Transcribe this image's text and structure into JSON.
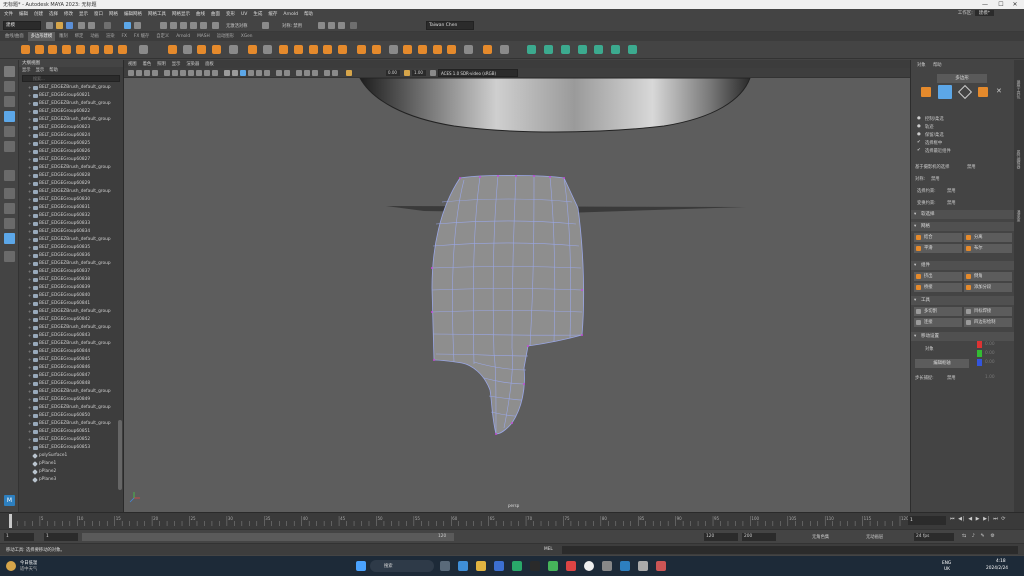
{
  "window": {
    "title": "无标题* - Autodesk MAYA 2023: 无标题",
    "controls": [
      "—",
      "☐",
      "✕"
    ]
  },
  "menubar": [
    "文件",
    "编辑",
    "创建",
    "选择",
    "修改",
    "显示",
    "窗口",
    "网格",
    "编辑网格",
    "网格工具",
    "网格显示",
    "曲线",
    "曲面",
    "变形",
    "UV",
    "生成",
    "缓存",
    "Arnold",
    "帮助"
  ],
  "workspace": {
    "label": "工作区:",
    "value": "建模*"
  },
  "statusline": {
    "mode": "建模",
    "symmetry": "无激活对称",
    "no_live": "对称: 禁用",
    "user": "Taiwan Chen"
  },
  "shelf_tabs": [
    "曲线/曲面",
    "多边形建模",
    "雕刻",
    "绑定",
    "动画",
    "渲染",
    "FX",
    "FX 缓存",
    "自定义",
    "Arnold",
    "MASH",
    "运动图形",
    "XGen"
  ],
  "shelf_active": "多边形建模",
  "outliner": {
    "title": "大纲视图",
    "menu": [
      "显示",
      "显示",
      "帮助"
    ],
    "search_placeholder": "搜索...",
    "items": [
      "BELT_EDGEZBrush_default_group",
      "BELT_EDGEGroup60821",
      "BELT_EDGEZBrush_default_group",
      "BELT_EDGEGroup60822",
      "BELT_EDGEZBrush_default_group",
      "BELT_EDGEGroup60823",
      "BELT_EDGEGroup60824",
      "BELT_EDGEGroup60825",
      "BELT_EDGEGroup60826",
      "BELT_EDGEGroup60827",
      "BELT_EDGEZBrush_default_group",
      "BELT_EDGEGroup60828",
      "BELT_EDGEGroup60829",
      "BELT_EDGEZBrush_default_group",
      "BELT_EDGEGroup60830",
      "BELT_EDGEGroup60831",
      "BELT_EDGEGroup60832",
      "BELT_EDGEGroup60833",
      "BELT_EDGEGroup60834",
      "BELT_EDGEZBrush_default_group",
      "BELT_EDGEGroup60835",
      "BELT_EDGEGroup60836",
      "BELT_EDGEZBrush_default_group",
      "BELT_EDGEGroup60837",
      "BELT_EDGEGroup60838",
      "BELT_EDGEGroup60839",
      "BELT_EDGEGroup60840",
      "BELT_EDGEGroup60841",
      "BELT_EDGEZBrush_default_group",
      "BELT_EDGEGroup60842",
      "BELT_EDGEZBrush_default_group",
      "BELT_EDGEGroup60843",
      "BELT_EDGEZBrush_default_group",
      "BELT_EDGEGroup60844",
      "BELT_EDGEGroup60845",
      "BELT_EDGEGroup60846",
      "BELT_EDGEGroup60847",
      "BELT_EDGEGroup60848",
      "BELT_EDGEZBrush_default_group",
      "BELT_EDGEGroup60849",
      "BELT_EDGEZBrush_default_group",
      "BELT_EDGEGroup60850",
      "BELT_EDGEZBrush_default_group",
      "BELT_EDGEGroup60851",
      "BELT_EDGEGroup60852",
      "BELT_EDGEGroup60853"
    ],
    "mesh_items": [
      "polySurface1",
      "pPlane1",
      "pPlane2",
      "pPlane3"
    ]
  },
  "viewport": {
    "menu": [
      "视图",
      "着色",
      "照明",
      "显示",
      "渲染器",
      "面板"
    ],
    "field_value": "0.00",
    "field_value2": "1.00",
    "colorspace": "ACES 1.0 SDR-video (sRGB)",
    "camera_label": "persp"
  },
  "attr_panel": {
    "tabs": [
      "对象",
      "帮助"
    ],
    "mode_button": "多边形",
    "options": [
      "控制/柔选",
      "轨迹",
      "保留/柔选",
      "选择框中",
      "选择最近组件"
    ],
    "soft_label": "基于摄影机的选择",
    "soft_value": "禁用",
    "symmetry_label": "对称:",
    "symmetry_value": "禁用",
    "edge_label": "选择约束:",
    "edge_value": "禁用",
    "tool_label": "变换约束:",
    "tool_value": "禁用",
    "sections": [
      {
        "title": "软选择",
        "collapsed": true
      },
      {
        "title": "网格",
        "buttons": [
          "结合",
          "分离",
          "平滑",
          "布尔"
        ]
      },
      {
        "title": "组件",
        "buttons": [
          "挤出",
          "倒角",
          "桥接",
          "添加分段"
        ]
      },
      {
        "title": "工具",
        "buttons": [
          "多切割",
          "目标焊接",
          "连接",
          "四边形绘制"
        ]
      },
      {
        "title": "移动设置"
      }
    ],
    "move_label": "对象",
    "move_button": "编辑枢轴",
    "step_label": "步长捕捉:",
    "step_value": "禁用",
    "coords": [
      "0.00",
      "0.00",
      "0.00"
    ],
    "step_num": "1.00"
  },
  "timeline": {
    "ticks": [
      "5",
      "10",
      "15",
      "20",
      "25",
      "30",
      "35",
      "40",
      "45",
      "50",
      "55",
      "60",
      "65",
      "70",
      "75",
      "80",
      "85",
      "90",
      "95",
      "100",
      "105",
      "110",
      "115",
      "120"
    ],
    "current_frame": "1"
  },
  "range": {
    "start": "1",
    "start2": "1",
    "end_inner": "120",
    "end": "120",
    "end2": "200",
    "char_set": "无角色集",
    "anim_layer": "无动画层",
    "fps": "24 fps"
  },
  "cmdline": {
    "lang": "MEL",
    "help": "移动工具: 选择要移动的对象。"
  },
  "taskbar": {
    "weather_title": "今日低温",
    "weather_sub": "适中天气",
    "search": "搜索",
    "lang_top": "ENG",
    "lang_bottom": "UK",
    "time": "4:18",
    "date": "2024/2/24"
  },
  "colors": {
    "accent_blue": "#5ca7e8",
    "orange_icon": "#e58a2c",
    "viewport_bg": "#5d5d5d",
    "mesh_fill": "#8e8e8e",
    "mesh_wire": "#9aa7e6",
    "vertex": "#c34bd6"
  }
}
